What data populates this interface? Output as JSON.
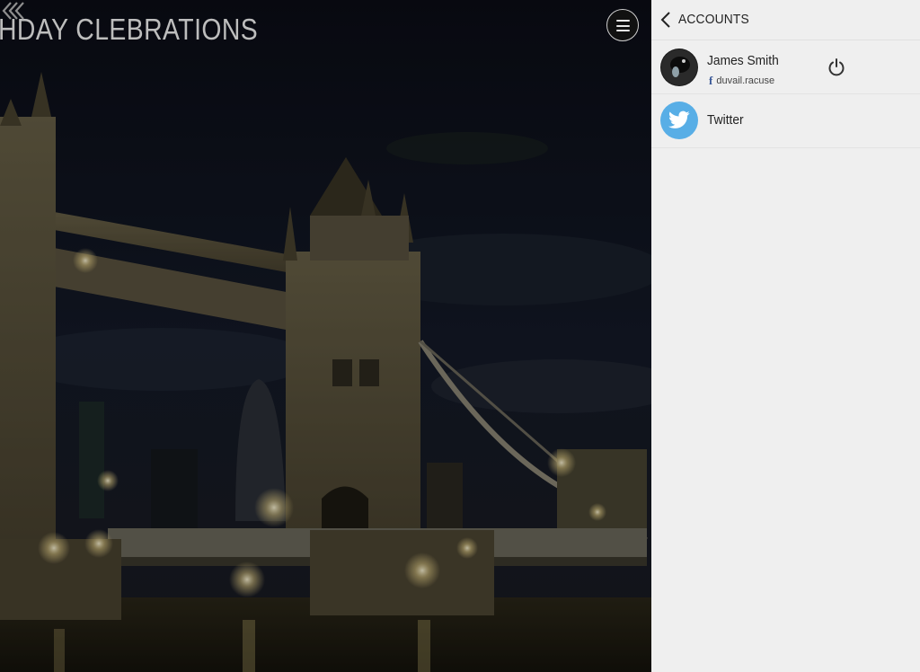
{
  "page": {
    "title": "HDAY CLEBRATIONS"
  },
  "icons": {
    "menu": "hamburger-menu-icon",
    "collapse": "double-chevron-left-icon",
    "back": "chevron-left-icon",
    "power": "power-icon",
    "facebook": "facebook-icon",
    "twitter": "twitter-bird-icon"
  },
  "panel": {
    "title": "ACCOUNTS",
    "accounts": [
      {
        "name": "James Smith",
        "handle": "duvail.racuse",
        "network": "facebook"
      },
      {
        "name": "Twitter",
        "network": "twitter"
      }
    ]
  },
  "colors": {
    "panel_bg": "#efefef",
    "twitter_blue": "#58aee6",
    "facebook_blue": "#3b5998"
  }
}
